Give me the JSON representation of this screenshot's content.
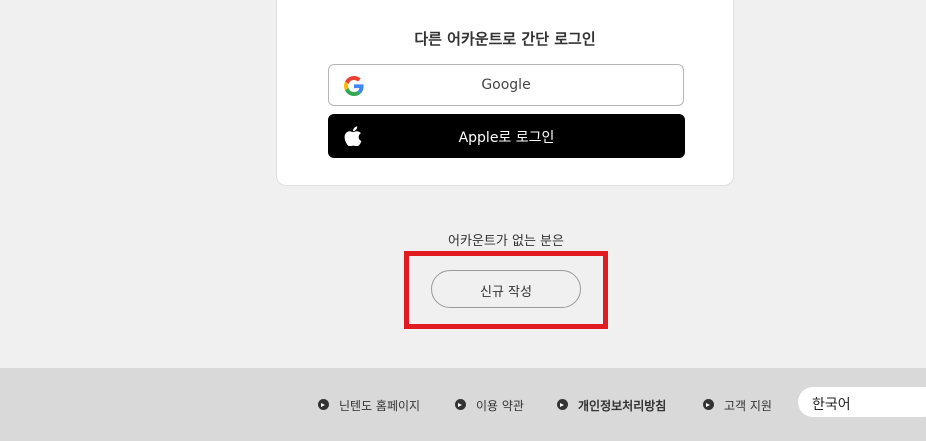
{
  "card": {
    "title": "다른 어카운트로 간단 로그인",
    "google_label": "Google",
    "apple_label": "Apple로 로그인"
  },
  "signup": {
    "prompt": "어카운트가 없는 분은",
    "button_label": "신규 작성"
  },
  "footer": {
    "links": [
      {
        "label": "닌텐도 홈페이지"
      },
      {
        "label": "이용 약관"
      },
      {
        "label": "개인정보처리방침"
      },
      {
        "label": "고객 지원"
      }
    ],
    "language": "한국어"
  },
  "colors": {
    "highlight": "#e21b23",
    "apple_button": "#000000",
    "footer_bg": "#d9d9d9",
    "page_bg": "#f0f0f0"
  },
  "icons": {
    "google": "google-logo-icon",
    "apple": "apple-logo-icon",
    "footer_link": "chevron-right-circle-icon"
  }
}
